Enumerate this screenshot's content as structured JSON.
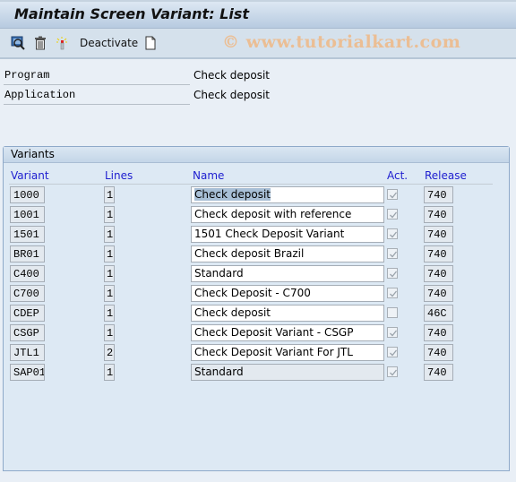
{
  "window": {
    "title": "Maintain Screen Variant: List"
  },
  "toolbar": {
    "items": [
      {
        "icon": "display-icon"
      },
      {
        "icon": "delete-icon"
      },
      {
        "icon": "activate-wand-icon"
      },
      {
        "label": "Deactivate"
      },
      {
        "icon": "new-document-icon"
      }
    ],
    "deactivate_label": "Deactivate",
    "watermark": "© www.tutorialkart.com"
  },
  "header_fields": [
    {
      "label": "Program",
      "value": "Check deposit"
    },
    {
      "label": "Application",
      "value": "Check deposit"
    }
  ],
  "variants": {
    "title": "Variants",
    "columns": [
      "Variant",
      "Lines",
      "Name",
      "Act.",
      "Release"
    ],
    "rows": [
      {
        "variant": "1000",
        "lines": "1",
        "name": "Check deposit",
        "active": true,
        "release": "740",
        "selected": true
      },
      {
        "variant": "1001",
        "lines": "1",
        "name": "Check deposit with reference",
        "active": true,
        "release": "740"
      },
      {
        "variant": "1501",
        "lines": "1",
        "name": "1501 Check Deposit Variant",
        "active": true,
        "release": "740"
      },
      {
        "variant": "BR01",
        "lines": "1",
        "name": "Check deposit Brazil",
        "active": true,
        "release": "740"
      },
      {
        "variant": "C400",
        "lines": "1",
        "name": "Standard",
        "active": true,
        "release": "740"
      },
      {
        "variant": "C700",
        "lines": "1",
        "name": "Check Deposit - C700",
        "active": true,
        "release": "740"
      },
      {
        "variant": "CDEP",
        "lines": "1",
        "name": "Check deposit",
        "active": false,
        "release": "46C"
      },
      {
        "variant": "CSGP",
        "lines": "1",
        "name": "Check Deposit Variant - CSGP",
        "active": true,
        "release": "740"
      },
      {
        "variant": "JTL1",
        "lines": "2",
        "name": "Check Deposit Variant For JTL",
        "active": true,
        "release": "740"
      },
      {
        "variant": "SAP01",
        "lines": "1",
        "name": "Standard",
        "active": true,
        "release": "740",
        "readonly": true
      }
    ]
  }
}
